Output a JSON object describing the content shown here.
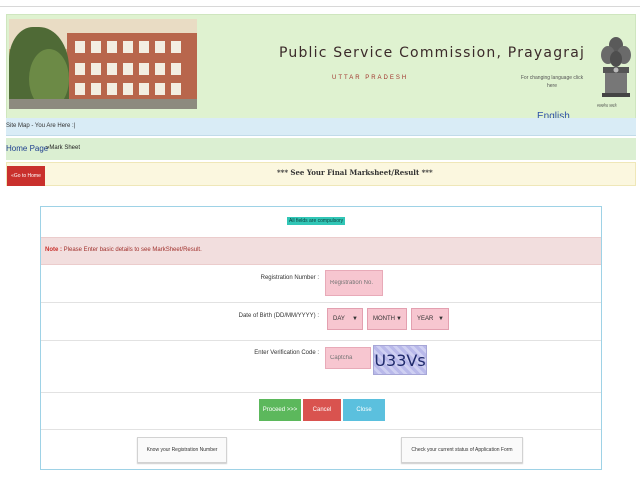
{
  "header": {
    "title": "Public Service Commission, Prayagraj",
    "subtitle": "UTTAR PRADESH",
    "lang_note": "For changing language click here",
    "lang_link": "English",
    "emblem_caption": "सत्यमेव जयते"
  },
  "sitemap": {
    "text": "Site Map - You Are Here :|"
  },
  "breadcrumb": {
    "home": "Home Page",
    "current": "»Mark Sheet"
  },
  "notice": {
    "go_back_label": "«Go to Home",
    "text": "*** See Your Final Marksheet/Result ***"
  },
  "form": {
    "legend": "All fields are compulsory",
    "note_label": "Note :",
    "note_text": " Please Enter basic details to see MarkSheet/Result.",
    "registration_label": "Registration Number :",
    "registration_placeholder": "Registration No.",
    "dob_label": "Date of Birth (DD/MM/YYYY) :",
    "day": "DAY",
    "month": "MONTH",
    "year": "YEAR",
    "captcha_label": "Enter Verification Code :",
    "captcha_placeholder": "Captcha",
    "captcha_code": "U33Vs",
    "proceed_label": "Proceed >>>",
    "cancel_label": "Cancel",
    "close_label": "Close",
    "know_reg_label": "Know your Registration Number",
    "check_status_label": "Check your current status of Application Form"
  },
  "colors": {
    "header_bg": "#dff2d0",
    "go_back": "#c9302c",
    "proceed": "#5cb85c",
    "cancel": "#d9534f",
    "close": "#5bc0de",
    "input_pink": "#f7c6d0"
  }
}
